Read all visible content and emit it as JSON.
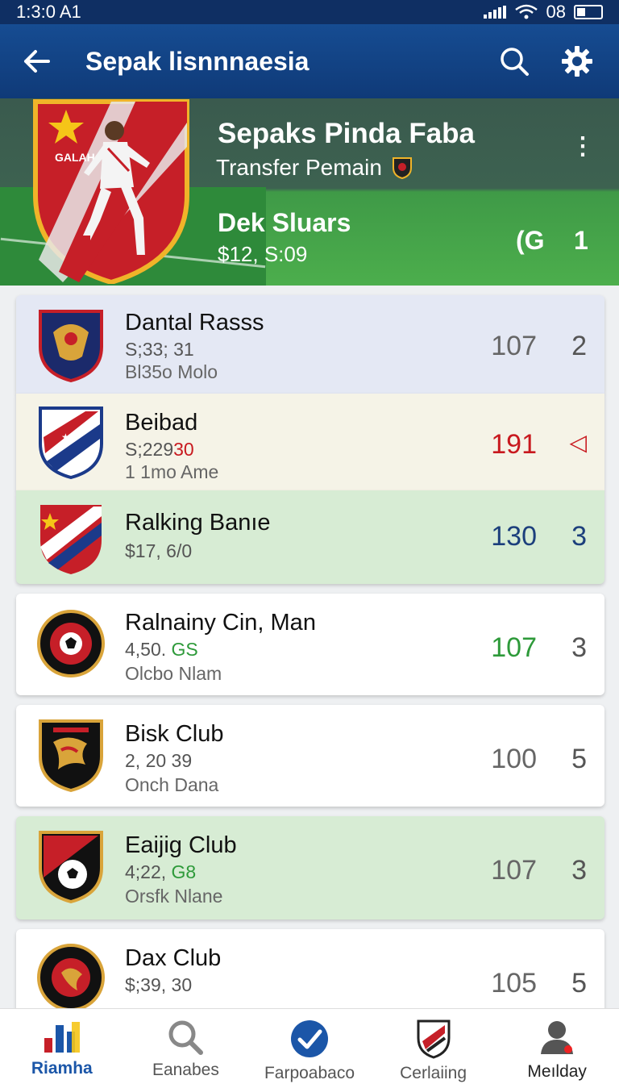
{
  "status": {
    "time": "1:3:0 A1",
    "battery_text": "08"
  },
  "appbar": {
    "title": "Sepak lisnnnaesia",
    "back_icon": "arrow-left-icon",
    "search_icon": "search-icon",
    "settings_icon": "gear-icon"
  },
  "featured": {
    "title": "Sepaks Pinda Faba",
    "subtitle": "Transfer Pemain",
    "name": "Dek Sluars",
    "price": "$12, S:09",
    "code": "(G",
    "rank": "1",
    "crest_text": "GALAH"
  },
  "clubs": [
    {
      "name": "Dantal Rasss",
      "line1": "S;33; 31",
      "line1_highlight": "",
      "line2": "Bl35o Molo",
      "score": "107",
      "rank": "2",
      "bg": "#e4e8f4",
      "score_color": "#666666",
      "rank_color": "#555555",
      "crest": "navy-eagle"
    },
    {
      "name": "Beibad",
      "line1": "S;229",
      "line1_highlight": "30",
      "line2": "1 1mo Ame",
      "score": "191",
      "rank": "◁",
      "bg": "#f5f3e7",
      "score_color": "#c8191f",
      "rank_color": "#c8191f",
      "crest": "white-stripes"
    },
    {
      "name": "Ralking Banıe",
      "line1": "$17, 6/0",
      "line1_highlight": "",
      "line2": "",
      "score": "130",
      "rank": "3",
      "bg": "#d7ecd4",
      "score_color": "#1c3f7c",
      "rank_color": "#1c3f7c",
      "crest": "red-stripes"
    },
    {
      "name": "Ralnainy Cin, Man",
      "line1": "4,50.",
      "line1_highlight": "GS",
      "line2": "Olcbo Nlam",
      "score": "107",
      "rank": "3",
      "bg": "#ffffff",
      "score_color": "#2e9a3a",
      "rank_color": "#555555",
      "crest": "black-ball"
    },
    {
      "name": "Bisk Club",
      "line1": "2, 20 39",
      "line1_highlight": "",
      "line2": "Onch Dana",
      "score": "100",
      "rank": "5",
      "bg": "#ffffff",
      "score_color": "#666666",
      "rank_color": "#555555",
      "crest": "black-dragon"
    },
    {
      "name": "Eaijig Club",
      "line1": "4;22,",
      "line1_highlight": "G8",
      "line2": "Orsfk Nlane",
      "score": "107",
      "rank": "3",
      "bg": "#d7ecd4",
      "score_color": "#666666",
      "rank_color": "#555555",
      "crest": "black-red-ball"
    },
    {
      "name": "Dax Club",
      "line1": "$;39, 30",
      "line1_highlight": "",
      "line2": "",
      "score": "105",
      "rank": "5",
      "bg": "#ffffff",
      "score_color": "#666666",
      "rank_color": "#555555",
      "crest": "black-gold"
    }
  ],
  "nav": [
    {
      "label": "Riamha",
      "icon": "bar-chart-icon",
      "active": true
    },
    {
      "label": "Eanabes",
      "icon": "search-icon",
      "active": false
    },
    {
      "label": "Farpoabaco",
      "icon": "check-circle-icon",
      "active": false
    },
    {
      "label": "Cerlaiing",
      "icon": "shield-icon",
      "active": false
    },
    {
      "label": "Meılday",
      "icon": "profile-icon",
      "active": false
    }
  ],
  "colors": {
    "primary": "#164c92",
    "accent_green": "#2e9a3a",
    "accent_red": "#c8191f"
  }
}
